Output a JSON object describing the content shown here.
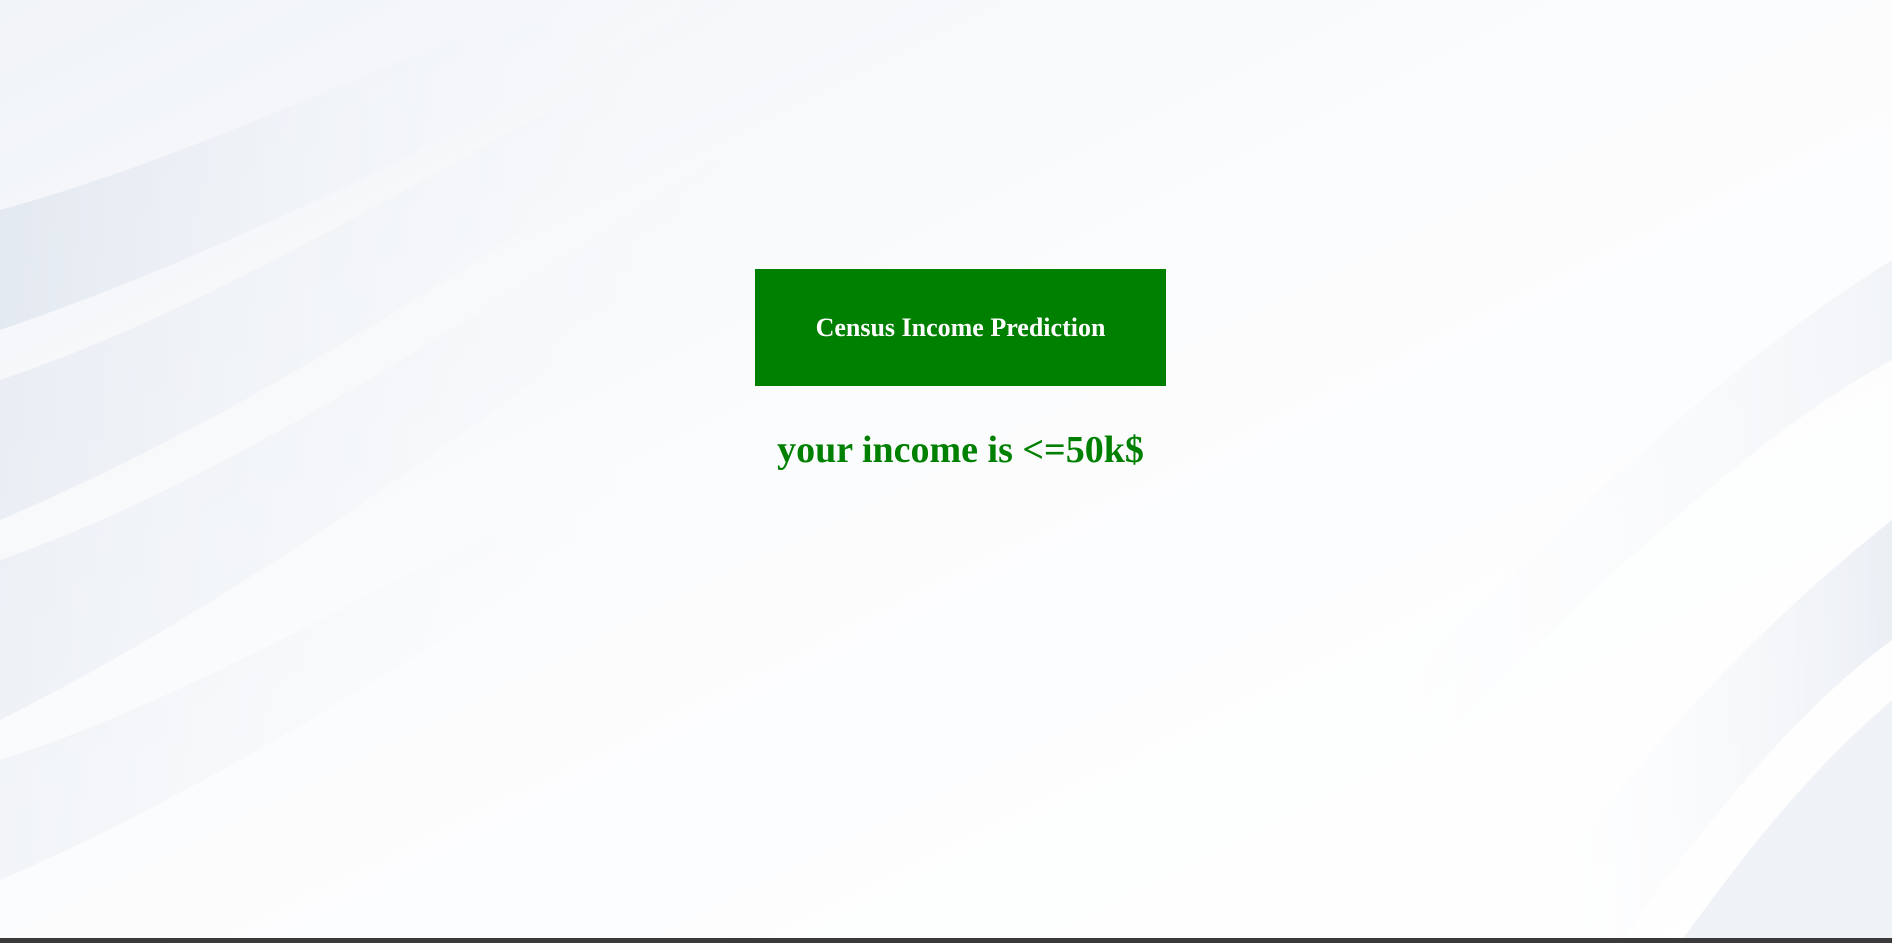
{
  "header": {
    "title": "Census Income Prediction"
  },
  "result": {
    "text": "your income is <=50k$"
  },
  "colors": {
    "accent_green": "#008000",
    "header_text": "#ffffff",
    "background": "#ffffff",
    "background_shade": "#dfe6ef"
  }
}
